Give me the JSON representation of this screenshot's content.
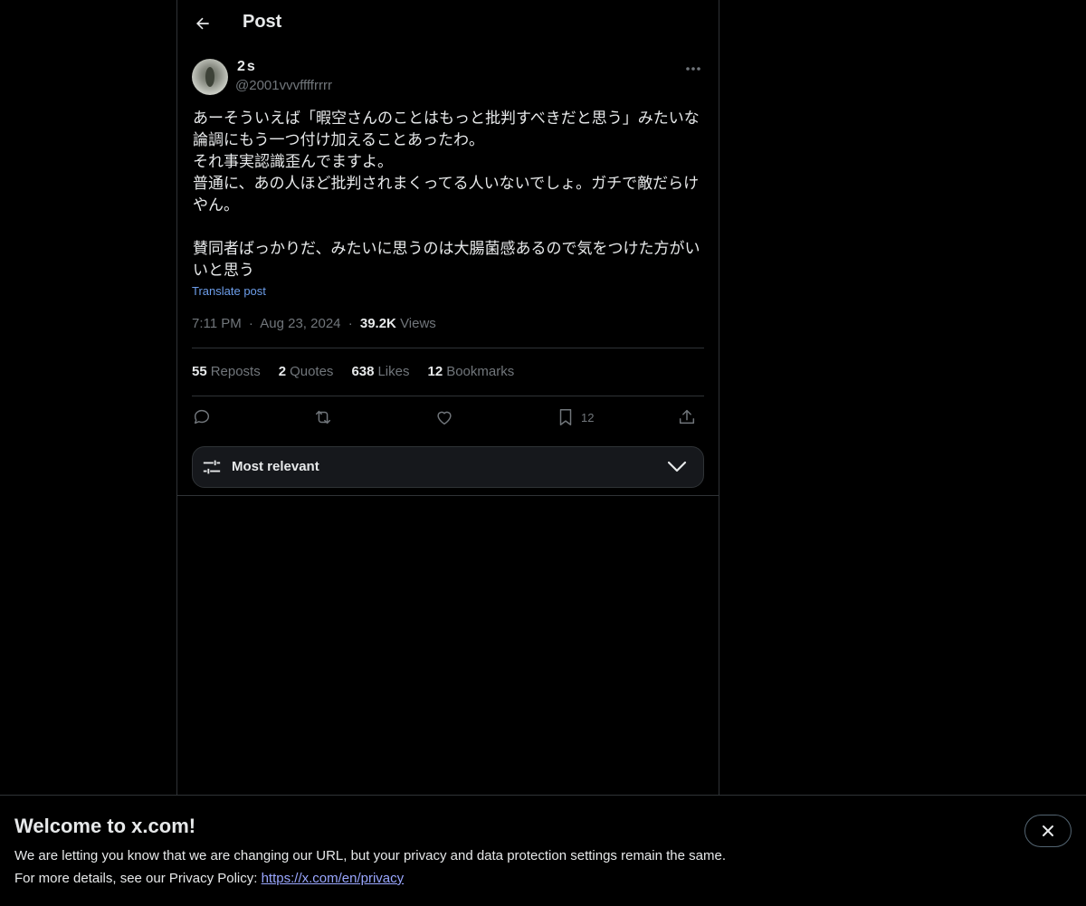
{
  "header": {
    "title": "Post",
    "back_icon": "arrow-left-icon"
  },
  "author": {
    "display_name": "2s",
    "handle": "@2001vvvffffrrrr"
  },
  "tweet": {
    "text": "あーそういえば「暇空さんのことはもっと批判すべきだと思う」みたいな\n論調にもう一つ付け加えることあったわ。\nそれ事実認識歪んでますよ。\n普通に、あの人ほど批判されまくってる人いないでしょ。ガチで敵だらけ\nやん。\n\n賛同者ばっかりだ、みたいに思うのは大腸菌感あるので気をつけた方がい\nいと思う",
    "translate_label": "Translate post",
    "time": "7:11 PM",
    "separator": "·",
    "date": "Aug 23, 2024",
    "views_count": "39.2K",
    "views_label": "Views"
  },
  "stats": [
    {
      "count": "55",
      "label": "Reposts"
    },
    {
      "count": "2",
      "label": "Quotes"
    },
    {
      "count": "638",
      "label": "Likes"
    },
    {
      "count": "12",
      "label": "Bookmarks"
    }
  ],
  "actions": {
    "bookmark_count": "12"
  },
  "sort": {
    "label": "Most relevant"
  },
  "banner": {
    "title": "Welcome to x.com!",
    "line1": "We are letting you know that we are changing our URL, but your privacy and data protection settings remain the same.",
    "line2_prefix": "For more details, see our Privacy Policy: ",
    "link": "https://x.com/en/privacy"
  },
  "colors": {
    "background": "#000000",
    "text": "#e7e9ea",
    "muted": "#71767b",
    "link": "#6d9eeb",
    "border": "#2f3336"
  }
}
